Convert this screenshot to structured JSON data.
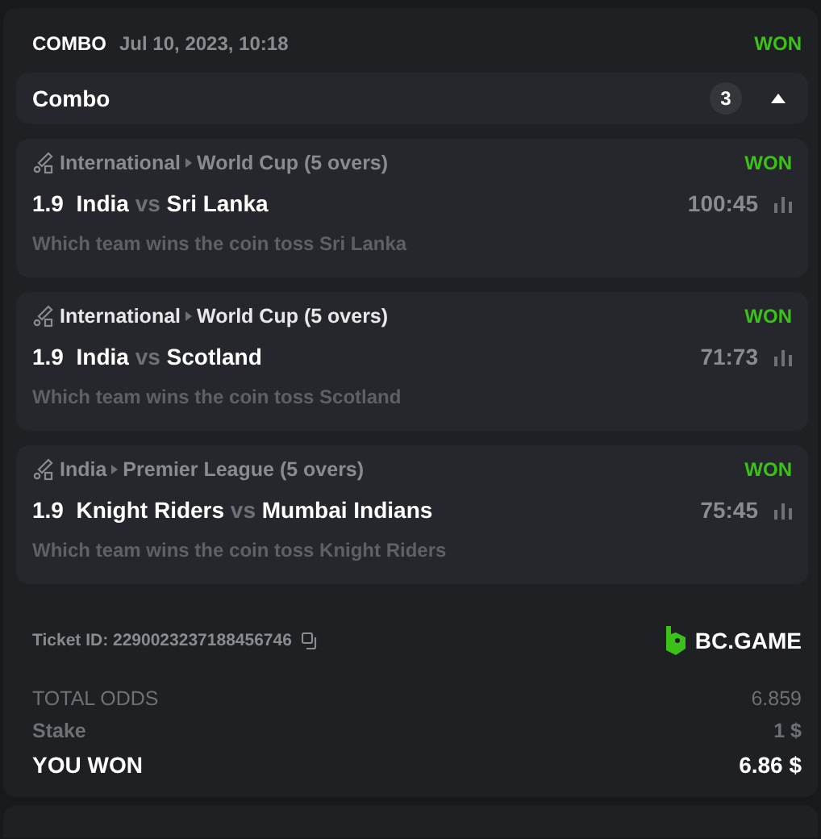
{
  "header": {
    "type": "COMBO",
    "date": "Jul 10, 2023, 10:18",
    "status": "WON"
  },
  "combo_bar": {
    "title": "Combo",
    "count": "3",
    "expanded": true
  },
  "bets": [
    {
      "category": "International",
      "league": "World Cup (5 overs)",
      "highlighted": false,
      "status": "WON",
      "odds": "1.9",
      "home": "India",
      "vs": "vs",
      "away": "Sri Lanka",
      "score": "100:45",
      "market": "Which team wins the coin toss Sri Lanka"
    },
    {
      "category": "International",
      "league": "World Cup (5 overs)",
      "highlighted": true,
      "status": "WON",
      "odds": "1.9",
      "home": "India",
      "vs": "vs",
      "away": "Scotland",
      "score": "71:73",
      "market": "Which team wins the coin toss Scotland"
    },
    {
      "category": "India",
      "league": "Premier League (5 overs)",
      "highlighted": false,
      "status": "WON",
      "odds": "1.9",
      "home": "Knight Riders",
      "vs": "vs",
      "away": "Mumbai Indians",
      "score": "75:45",
      "market": "Which team wins the coin toss Knight Riders"
    }
  ],
  "ticket": {
    "id": "Ticket ID: 2290023237188456746",
    "brand": "BC.GAME"
  },
  "summary": [
    {
      "kind": "plain",
      "label": "TOTAL ODDS",
      "value": "6.859"
    },
    {
      "kind": "plain",
      "label": "Stake",
      "value": "1 $"
    },
    {
      "kind": "total",
      "label": "YOU WON",
      "value": "6.86 $"
    }
  ]
}
